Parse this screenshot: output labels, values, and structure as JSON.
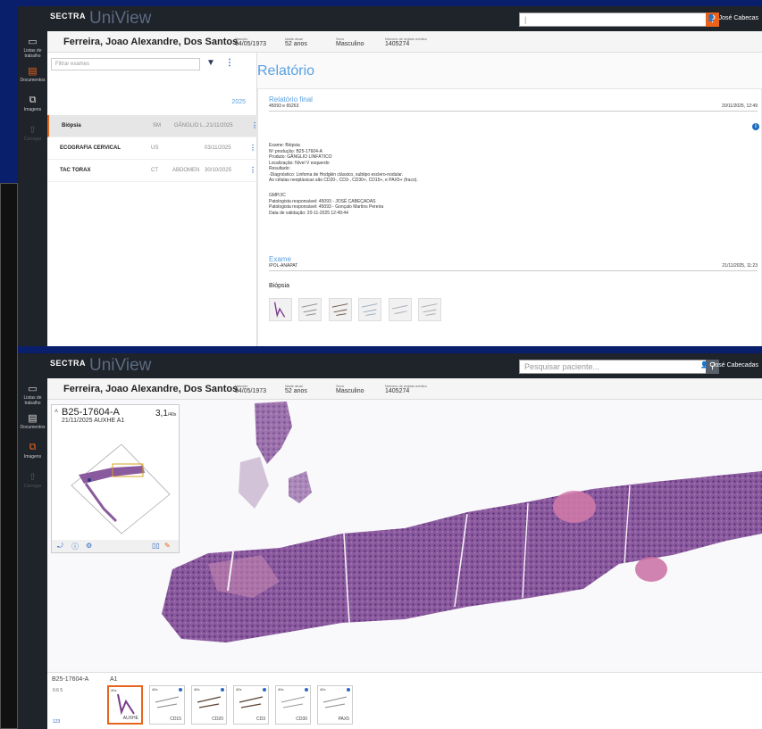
{
  "app": {
    "brand": "SECTRA",
    "product": "UniView"
  },
  "top1": {
    "search_value": "",
    "user": "José Cabecas"
  },
  "top2": {
    "search_placeholder": "Pesquisar paciente...",
    "user": "José Cabecadas"
  },
  "sidebar": [
    {
      "icon": "clipboard-icon",
      "label": "Listas de trabalho"
    },
    {
      "icon": "document-icon",
      "label": "Documentos"
    },
    {
      "icon": "images-icon",
      "label": "Imagens"
    },
    {
      "icon": "upload-icon",
      "label": "Carregar"
    }
  ],
  "patient": {
    "name": "Ferreira, Joao Alexandre, Dos Santos",
    "dob_label": "Nascido",
    "dob": "04/05/1973",
    "age_label": "Idade atual",
    "age": "52 anos",
    "sex_label": "Sexo",
    "sex": "Masculino",
    "id_label": "Número de registo médico",
    "id": "1405274"
  },
  "exams": {
    "filter_placeholder": "Filtrar exames",
    "year": "2025",
    "rows": [
      {
        "name": "Biópsia",
        "modality": "SM",
        "organ": "GÂNGLIO L...",
        "date": "21/11/2025"
      },
      {
        "name": "ECOGRAFIA CERVICAL",
        "modality": "US",
        "organ": "",
        "date": "03/11/2025"
      },
      {
        "name": "TAC TORAX",
        "modality": "CT",
        "organ": "ABDOMEN",
        "date": "30/10/2025"
      }
    ]
  },
  "report": {
    "title": "Relatório",
    "final_heading": "Relatório final",
    "final_ids": "45093 e 65263",
    "final_date": "20/11/2025, 12:49",
    "body": [
      "Exame: Biópsia",
      "Nº produção: B25-17604-A",
      "Produto: GÂNGLIO LINFÁTICO",
      "Localização: Nível V esquerdo",
      "Resultado:",
      "-Diagnóstico: Linfoma de Hodgkin clássico, subtipo esclero-nodular.",
      "As células neoplásicas são CD20-, CD3-, CD30+, CD15+, e PAX5+ (fraco)."
    ],
    "footer": [
      "GMP/JC",
      "Patologista responsável: 45093 - JOSÉ CABEÇADAS",
      "Patologista responsável: 45093 - Gonçalo Martins Pereira",
      "Data de validação: 20-11-2025 12:49:44"
    ],
    "exam_heading": "Exame",
    "exam_source": "IPOL-ANAPAT",
    "exam_date": "21/11/2025, 11:23",
    "exam_name": "Biópsia"
  },
  "viewer": {
    "case_id": "B25-17604-A",
    "case_sub": "21/11/2025   AUXHE   A1",
    "zoom": "3,1",
    "zoom_unit": "/40x"
  },
  "bottom": {
    "case_id": "B25-17604-A",
    "block": "A1",
    "stats": "6:6   5",
    "count": "123",
    "slides": [
      {
        "mag": "40x",
        "stain": "AUXHE"
      },
      {
        "mag": "40x",
        "stain": "CD15"
      },
      {
        "mag": "40x",
        "stain": "CD20"
      },
      {
        "mag": "40x",
        "stain": "CD3"
      },
      {
        "mag": "40x",
        "stain": "CD30"
      },
      {
        "mag": "40x",
        "stain": "PAX5"
      }
    ]
  },
  "colors": {
    "accent": "#e8641d",
    "link": "#5aa0e0",
    "bar": "#1f232a",
    "bg": "#0a1f6b"
  }
}
